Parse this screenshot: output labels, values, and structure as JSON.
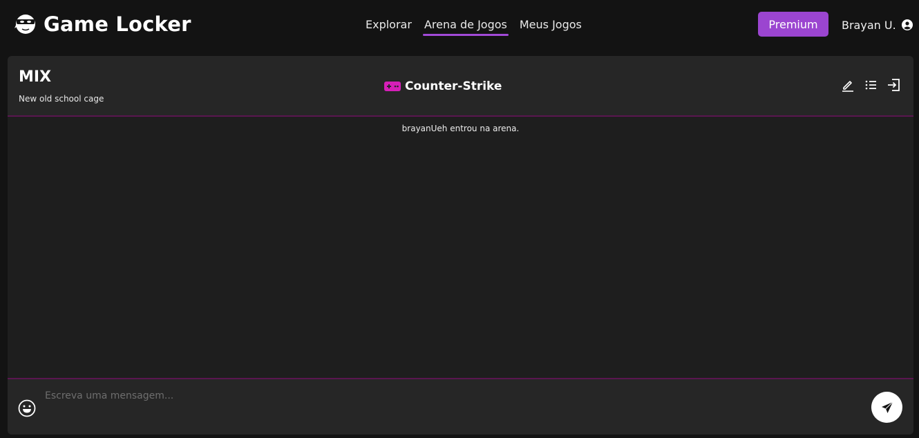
{
  "app": {
    "name": "Game Locker",
    "logo_icon": "ninja-mask-icon"
  },
  "nav": {
    "items": [
      {
        "label": "Explorar",
        "active": false
      },
      {
        "label": "Arena de Jogos",
        "active": true
      },
      {
        "label": "Meus Jogos",
        "active": false
      }
    ]
  },
  "header": {
    "premium_label": "Premium",
    "user_name": "Brayan U.",
    "user_icon": "user-circle-icon"
  },
  "arena": {
    "title": "MIX",
    "description": "New old school cage",
    "game": "Counter-Strike",
    "game_icon": "gamepad-icon",
    "actions": [
      "edit-icon",
      "list-icon",
      "exit-icon"
    ]
  },
  "messages": [
    {
      "type": "system",
      "text": "brayanUeh entrou na arena."
    }
  ],
  "composer": {
    "placeholder": "Escreva uma mensagem...",
    "value": ""
  },
  "colors": {
    "accent": "#9b45d0",
    "divider": "#5a1650",
    "gamepad": "#d61fb8",
    "background": "#131313",
    "panel": "#1e1e1e"
  }
}
